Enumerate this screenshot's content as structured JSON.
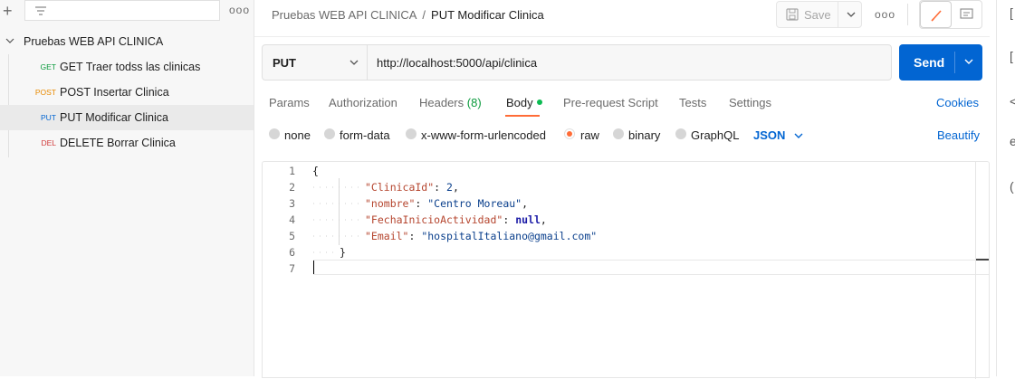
{
  "sidebar": {
    "add_icon": "plus-icon",
    "filter_icon": "filter-lines-icon",
    "more_label": "ooo",
    "collection_name": "Pruebas WEB API CLINICA",
    "requests": [
      {
        "method": "GET",
        "name": "GET Traer todss las clinicas",
        "color": "#0a9a3c"
      },
      {
        "method": "POST",
        "name": "POST Insertar Clinica",
        "color": "#e88a00"
      },
      {
        "method": "PUT",
        "name": "PUT Modificar Clinica",
        "color": "#0265d2",
        "selected": true
      },
      {
        "method": "DEL",
        "name": "DELETE Borrar Clinica",
        "color": "#d13b3b"
      }
    ]
  },
  "header": {
    "collection": "Pruebas WEB API CLINICA",
    "separator": "/",
    "request": "PUT Modificar Clinica",
    "save_label": "Save",
    "more_label": "ooo"
  },
  "request": {
    "method": "PUT",
    "url": "http://localhost:5000/api/clinica",
    "send_label": "Send"
  },
  "tabs": {
    "params": "Params",
    "authorization": "Authorization",
    "headers": "Headers",
    "headers_count": "(8)",
    "body": "Body",
    "prescript": "Pre-request Script",
    "tests": "Tests",
    "settings": "Settings",
    "cookies": "Cookies"
  },
  "body_types": {
    "none": "none",
    "form_data": "form-data",
    "urlencoded": "x-www-form-urlencoded",
    "raw": "raw",
    "binary": "binary",
    "graphql": "GraphQL",
    "format": "JSON",
    "beautify": "Beautify",
    "selected": "raw"
  },
  "editor": {
    "line_numbers": [
      "1",
      "2",
      "3",
      "4",
      "5",
      "6",
      "7"
    ],
    "open_brace": "{",
    "close_brace": "}",
    "fields": [
      {
        "key": "\"ClinicaId\"",
        "value": "2",
        "value_type": "number",
        "trailing": ","
      },
      {
        "key": "\"nombre\"",
        "value": "\"Centro Moreau\"",
        "value_type": "string",
        "trailing": ","
      },
      {
        "key": "\"FechaInicioActividad\"",
        "value": "null",
        "value_type": "keyword",
        "trailing": ","
      },
      {
        "key": "\"Email\"",
        "value": "\"hospitalItaliano@gmail.com\"",
        "value_type": "string",
        "trailing": ""
      }
    ]
  },
  "colors": {
    "accent_orange": "#ff6c37",
    "send_blue": "#0265d2",
    "body_dot_green": "#0cbb52"
  }
}
